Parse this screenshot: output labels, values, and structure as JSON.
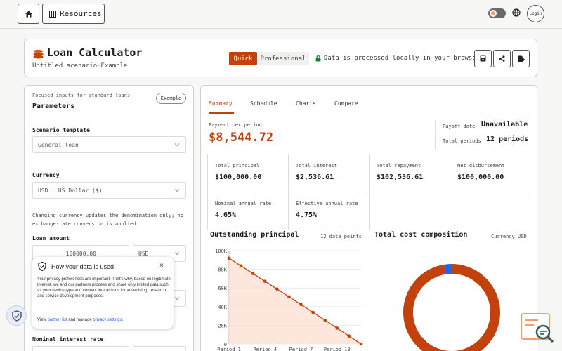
{
  "topbar": {
    "resources_label": "Resources",
    "login_label": "Login",
    "icons": [
      "home-icon",
      "grid-icon",
      "theme-toggle",
      "globe-icon"
    ]
  },
  "header": {
    "title": "Loan Calculator",
    "subtitle": "Untitled scenario·Example",
    "mode_quick": "Quick",
    "mode_professional": "Professional",
    "local_note": "Data is processed locally in your browser",
    "accent": "#c2410c"
  },
  "parameters": {
    "hint": "Focused inputs for standard loans",
    "title": "Parameters",
    "example_label": "Example",
    "scenario_label": "Scenario template",
    "scenario_value": "General loan",
    "currency_label": "Currency",
    "currency_value": "USD · US Dollar ($)",
    "currency_note": "Changing currency updates the denomination only; no exchange-rate conversion is applied.",
    "loan_amount_label": "Loan amount",
    "loan_amount_value": "100000.00",
    "loan_amount_unit": "USD",
    "interest_label": "Nominal interest rate"
  },
  "summary": {
    "tabs": [
      "Summary",
      "Schedule",
      "Charts",
      "Compare"
    ],
    "payment_label": "Payment per period",
    "payment_value": "$8,544.72",
    "payoff_label": "Payoff date",
    "payoff_value": "Unavailable",
    "periods_label": "Total periods",
    "periods_value": "12 periods",
    "cells": [
      {
        "k": "Total principal",
        "v": "$100,000.00"
      },
      {
        "k": "Total interest",
        "v": "$2,536.61"
      },
      {
        "k": "Total repayment",
        "v": "$102,536.61"
      },
      {
        "k": "Net disbursement",
        "v": "$100,000.00"
      },
      {
        "k": "Nominal annual rate",
        "v": "4.65%"
      },
      {
        "k": "Effective annual rate",
        "v": "4.75%"
      }
    ]
  },
  "charts": {
    "principal_title": "Outstanding principal",
    "principal_meta": "12 data points",
    "composition_title": "Total cost composition",
    "composition_meta": "Currency USD"
  },
  "chart_data": [
    {
      "type": "area",
      "title": "Outstanding principal",
      "ytick_labels": [
        "100K",
        "80K",
        "60K",
        "40K",
        "20K",
        "0"
      ],
      "xtick_labels": [
        "Period 1",
        "Period 4",
        "Period 7",
        "Period 10"
      ],
      "ylim": [
        0,
        100000
      ],
      "x": [
        1,
        2,
        3,
        4,
        5,
        6,
        7,
        8,
        9,
        10,
        11,
        12
      ],
      "values": [
        91843,
        83654,
        75432,
        67178,
        58892,
        50573,
        42222,
        33838,
        25422,
        16972,
        8489,
        0
      ],
      "color": "#c2410c",
      "grid": true
    },
    {
      "type": "pie",
      "title": "Total cost composition",
      "values": [
        100000,
        2536.61
      ],
      "colors": [
        "#c2410c",
        "#2563eb"
      ]
    }
  ],
  "privacy": {
    "title": "How your data is used",
    "body": "Your privacy preferences are important. That's why, based on legitimate interest, we and our partners process and share only limited data such as your device type and content interactions for advertising, research and service development purposes.",
    "view": "View ",
    "partner_list": "partner list",
    "manage": " and manage ",
    "privacy_settings": "privacy settings",
    "period": ".",
    "close": "×"
  }
}
